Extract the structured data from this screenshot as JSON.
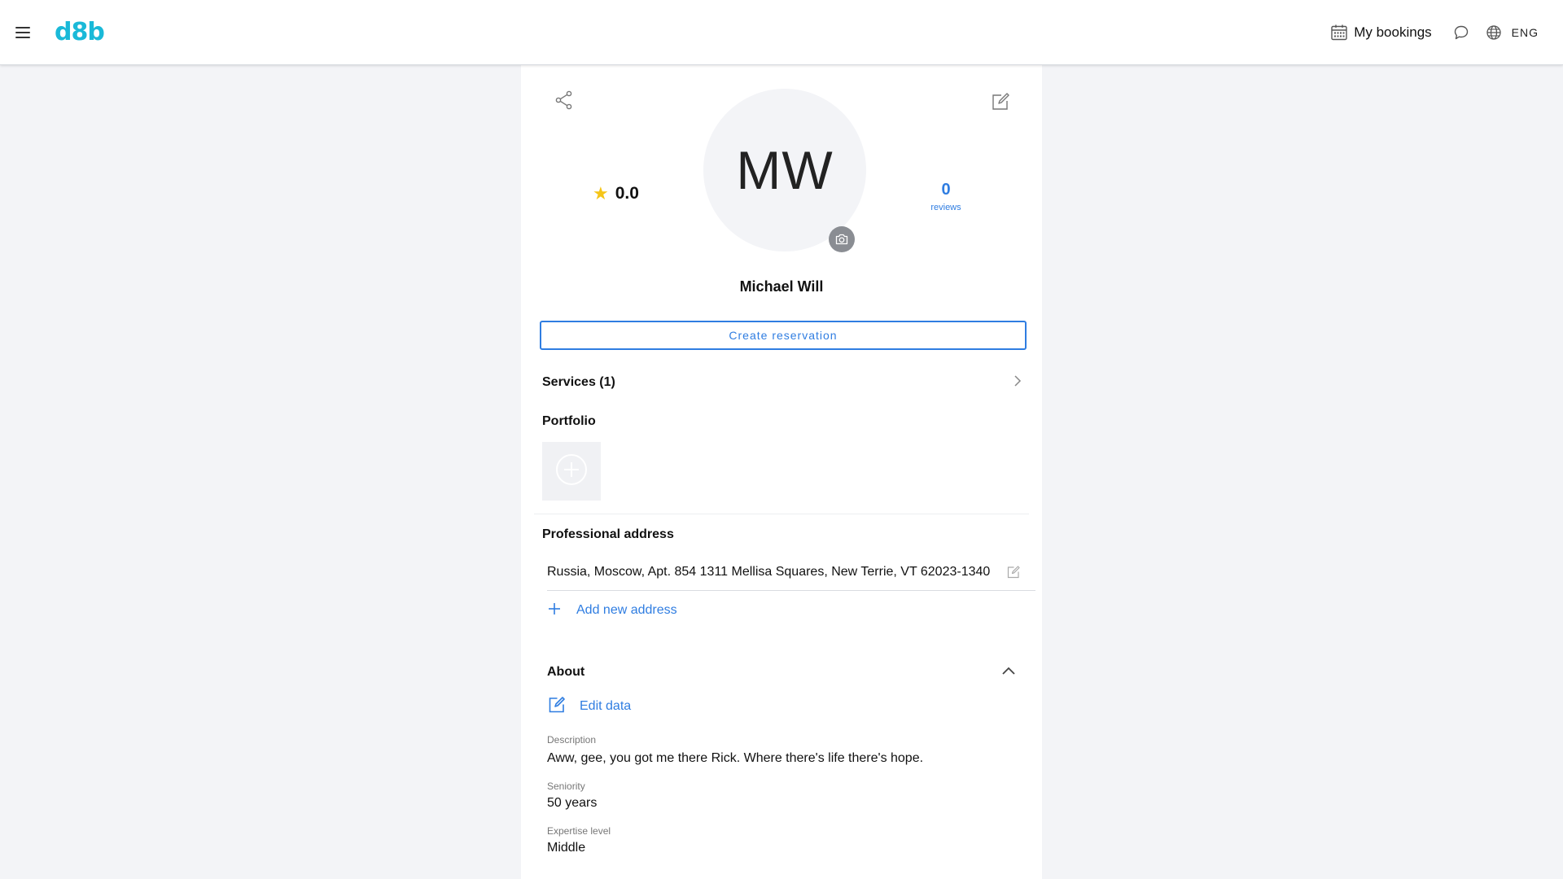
{
  "header": {
    "logo": "d8b",
    "bookings_label": "My bookings",
    "language": "ENG"
  },
  "profile": {
    "initials": "MW",
    "name": "Michael Will",
    "rating": "0.0",
    "reviews_count": "0",
    "reviews_label": "reviews"
  },
  "actions": {
    "create_reservation": "Create reservation"
  },
  "services": {
    "label": "Services (1)"
  },
  "portfolio": {
    "title": "Portfolio"
  },
  "address": {
    "title": "Professional address",
    "items": [
      "Russia, Moscow, Apt. 854 1311 Mellisa Squares, New Terrie, VT 62023-1340"
    ],
    "add_label": "Add new address"
  },
  "about": {
    "title": "About",
    "edit_label": "Edit data",
    "description_label": "Description",
    "description": "Aww, gee, you got me there Rick. Where there's life there's hope.",
    "seniority_label": "Seniority",
    "seniority": "50 years",
    "expertise_label": "Expertise level",
    "expertise": "Middle"
  },
  "colors": {
    "accent": "#2f7de1",
    "brand": "#1ab9d8",
    "star": "#f5c518",
    "background": "#f3f4f7"
  },
  "icons": [
    "menu-icon",
    "calendar-icon",
    "chat-icon",
    "globe-icon",
    "share-icon",
    "edit-icon",
    "camera-icon",
    "star-icon",
    "chevron-right-icon",
    "plus-circle-icon",
    "plus-icon",
    "chevron-up-icon"
  ]
}
